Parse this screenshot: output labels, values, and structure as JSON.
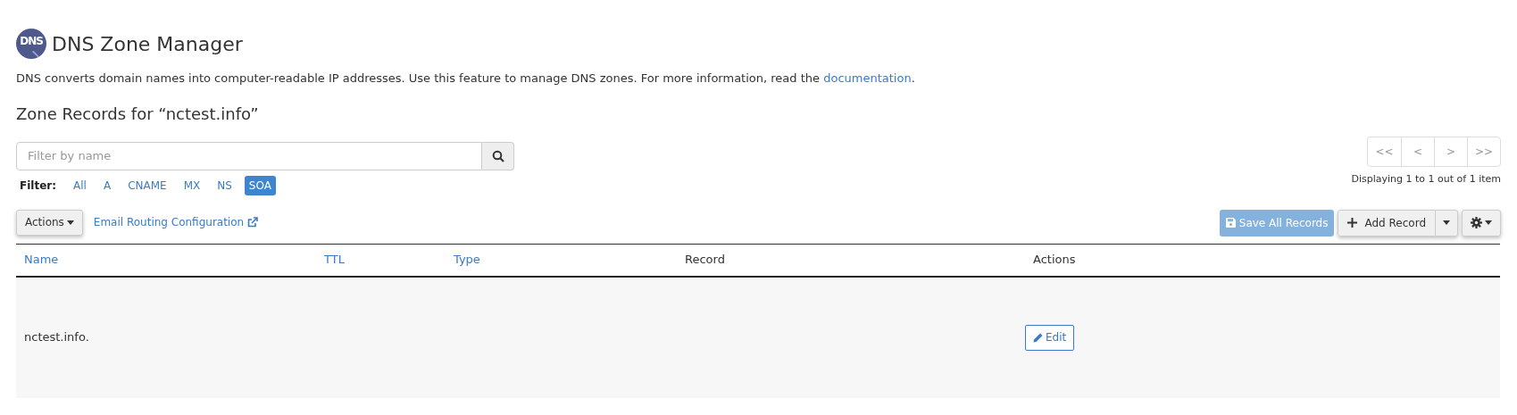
{
  "header": {
    "title": "DNS Zone Manager",
    "logo_text": "DNS"
  },
  "description": {
    "text": "DNS converts domain names into computer-readable IP addresses. Use this feature to manage DNS zones. For more information, read the",
    "link": "documentation",
    "after": "."
  },
  "zone_heading": "Zone Records for “nctest.info”",
  "search": {
    "placeholder": "Filter by name"
  },
  "filter": {
    "label": "Filter:",
    "options": [
      {
        "label": "All",
        "selected": false
      },
      {
        "label": "A",
        "selected": false
      },
      {
        "label": "CNAME",
        "selected": false
      },
      {
        "label": "MX",
        "selected": false
      },
      {
        "label": "NS",
        "selected": false
      },
      {
        "label": "SOA",
        "selected": true
      }
    ]
  },
  "pagination": {
    "buttons": [
      "<<",
      "<",
      ">",
      ">>"
    ],
    "summary": "Displaying 1 to 1 out of 1 item"
  },
  "toolbar": {
    "actions_button": "Actions",
    "email_link": "Email Routing Configuration",
    "save_button": {
      "label": "Save All Records",
      "disabled": true
    },
    "add_button": "Add Record"
  },
  "table": {
    "columns": [
      {
        "label": "Name",
        "sortable": true
      },
      {
        "label": "TTL",
        "sortable": true
      },
      {
        "label": "Type",
        "sortable": true
      },
      {
        "label": "Record",
        "sortable": false
      },
      {
        "label": "Actions",
        "sortable": false
      }
    ],
    "rows": [
      {
        "name": "nctest.info.",
        "action": "Edit"
      }
    ]
  }
}
